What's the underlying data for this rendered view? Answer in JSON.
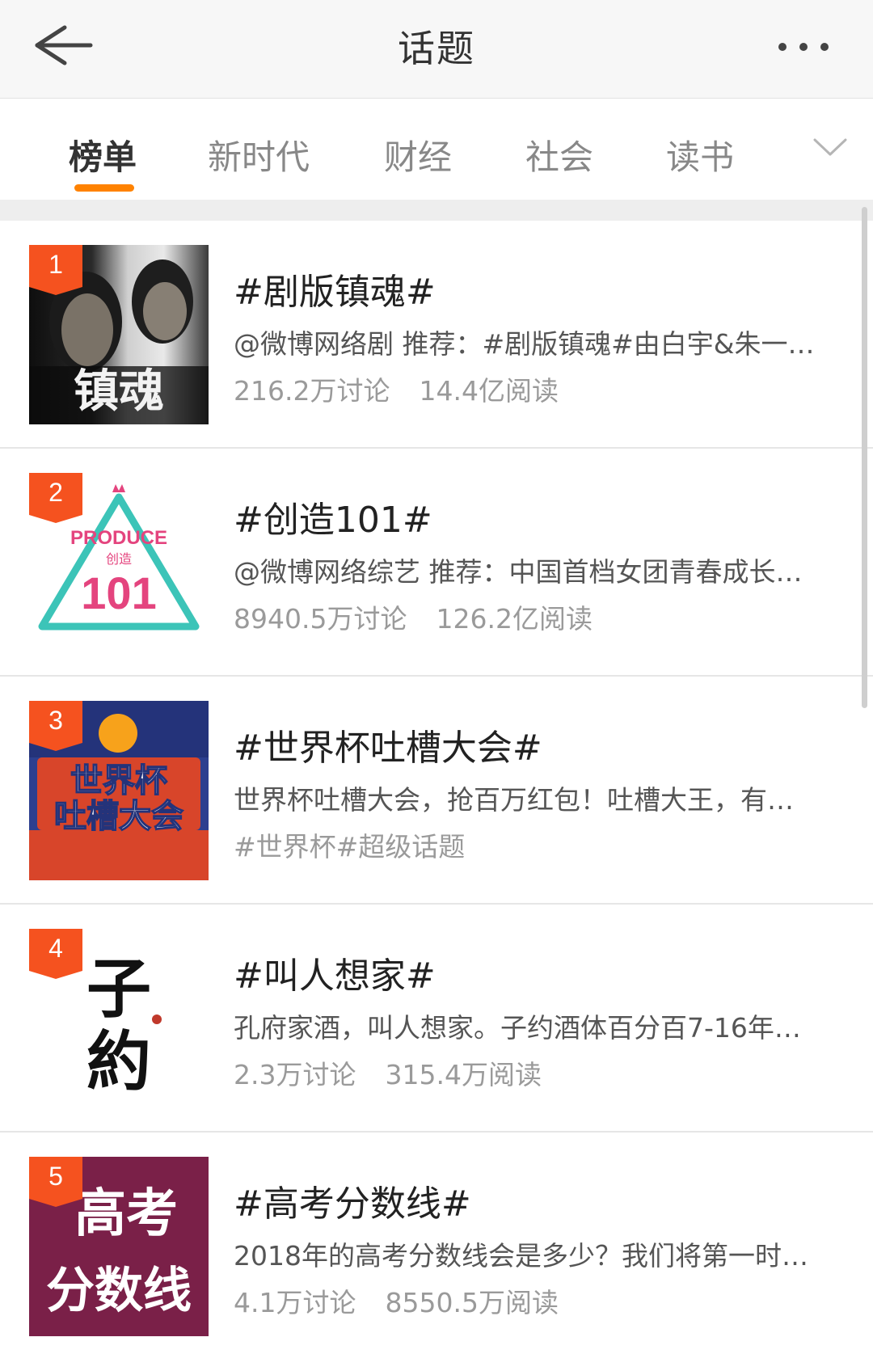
{
  "header": {
    "title": "话题",
    "back_icon": "back-arrow-icon",
    "more_icon": "more-dots-icon"
  },
  "tabs": {
    "items": [
      {
        "label": "榜单",
        "active": true
      },
      {
        "label": "新时代",
        "active": false
      },
      {
        "label": "财经",
        "active": false
      },
      {
        "label": "社会",
        "active": false
      },
      {
        "label": "读书",
        "active": false
      }
    ],
    "expand_icon": "chevron-down-icon",
    "accent_color": "#ff8200"
  },
  "topics": [
    {
      "rank": "1",
      "title": "#剧版镇魂#",
      "desc": "@微博网络剧 推荐：#剧版镇魂#由白宇&朱一…",
      "discussions": "216.2万讨论",
      "reads": "14.4亿阅读",
      "thumb": {
        "caption": "镇魂"
      }
    },
    {
      "rank": "2",
      "title": "#创造101#",
      "desc": "@微博网络综艺 推荐：中国首档女团青春成长…",
      "discussions": "8940.5万讨论",
      "reads": "126.2亿阅读",
      "thumb": {
        "line1": "PRODUCE",
        "line2": "创造",
        "line3": "101"
      }
    },
    {
      "rank": "3",
      "title": "#世界杯吐槽大会#",
      "desc": "世界杯吐槽大会，抢百万红包！吐槽大王，有…",
      "tags": "#世界杯#超级话题",
      "thumb": {
        "line1": "世界杯",
        "line2": "吐槽大会"
      }
    },
    {
      "rank": "4",
      "title": "#叫人想家#",
      "desc": "孔府家酒，叫人想家。子约酒体百分百7-16年…",
      "discussions": "2.3万讨论",
      "reads": "315.4万阅读",
      "thumb": {
        "line1": "子",
        "line2": "約"
      }
    },
    {
      "rank": "5",
      "title": "#高考分数线#",
      "desc": "2018年的高考分数线会是多少？我们将第一时…",
      "discussions": "4.1万讨论",
      "reads": "8550.5万阅读",
      "thumb": {
        "line1": "高考",
        "line2": "分数线"
      }
    }
  ],
  "colors": {
    "badge": "#f5521f",
    "thumb5_bg": "#7a2048",
    "thumb3_bg": "#2d3f8f"
  }
}
